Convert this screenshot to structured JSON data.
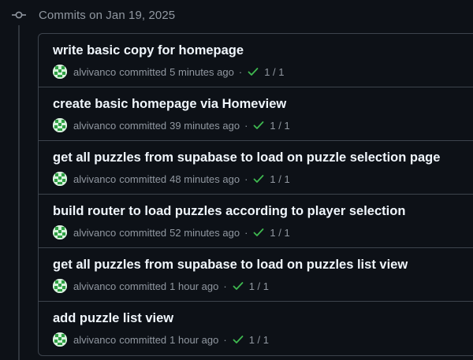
{
  "group": {
    "title": "Commits on Jan 19, 2025"
  },
  "commits": [
    {
      "message": "write basic copy for homepage",
      "author": "alvivanco",
      "committed": "committed",
      "time": "5 minutes ago",
      "separator": "·",
      "checks": "1 / 1"
    },
    {
      "message": "create basic homepage via Homeview",
      "author": "alvivanco",
      "committed": "committed",
      "time": "39 minutes ago",
      "separator": "·",
      "checks": "1 / 1"
    },
    {
      "message": "get all puzzles from supabase to load on puzzle selection page",
      "author": "alvivanco",
      "committed": "committed",
      "time": "48 minutes ago",
      "separator": "·",
      "checks": "1 / 1"
    },
    {
      "message": "build router to load puzzles according to player selection",
      "author": "alvivanco",
      "committed": "committed",
      "time": "52 minutes ago",
      "separator": "·",
      "checks": "1 / 1"
    },
    {
      "message": "get all puzzles from supabase to load on puzzles list view",
      "author": "alvivanco",
      "committed": "committed",
      "time": "1 hour ago",
      "separator": "·",
      "checks": "1 / 1"
    },
    {
      "message": "add puzzle list view",
      "author": "alvivanco",
      "committed": "committed",
      "time": "1 hour ago",
      "separator": "·",
      "checks": "1 / 1"
    }
  ],
  "colors": {
    "background": "#0d1117",
    "border": "#3d444d",
    "text_primary": "#f0f6fc",
    "text_muted": "#9198a1",
    "success": "#3fb950",
    "avatar_bg": "#d8f2dd",
    "avatar_fg": "#2ea043"
  },
  "icons": {
    "group": "git-commit-icon",
    "avatar": "identicon-avatar",
    "status": "check-icon"
  }
}
